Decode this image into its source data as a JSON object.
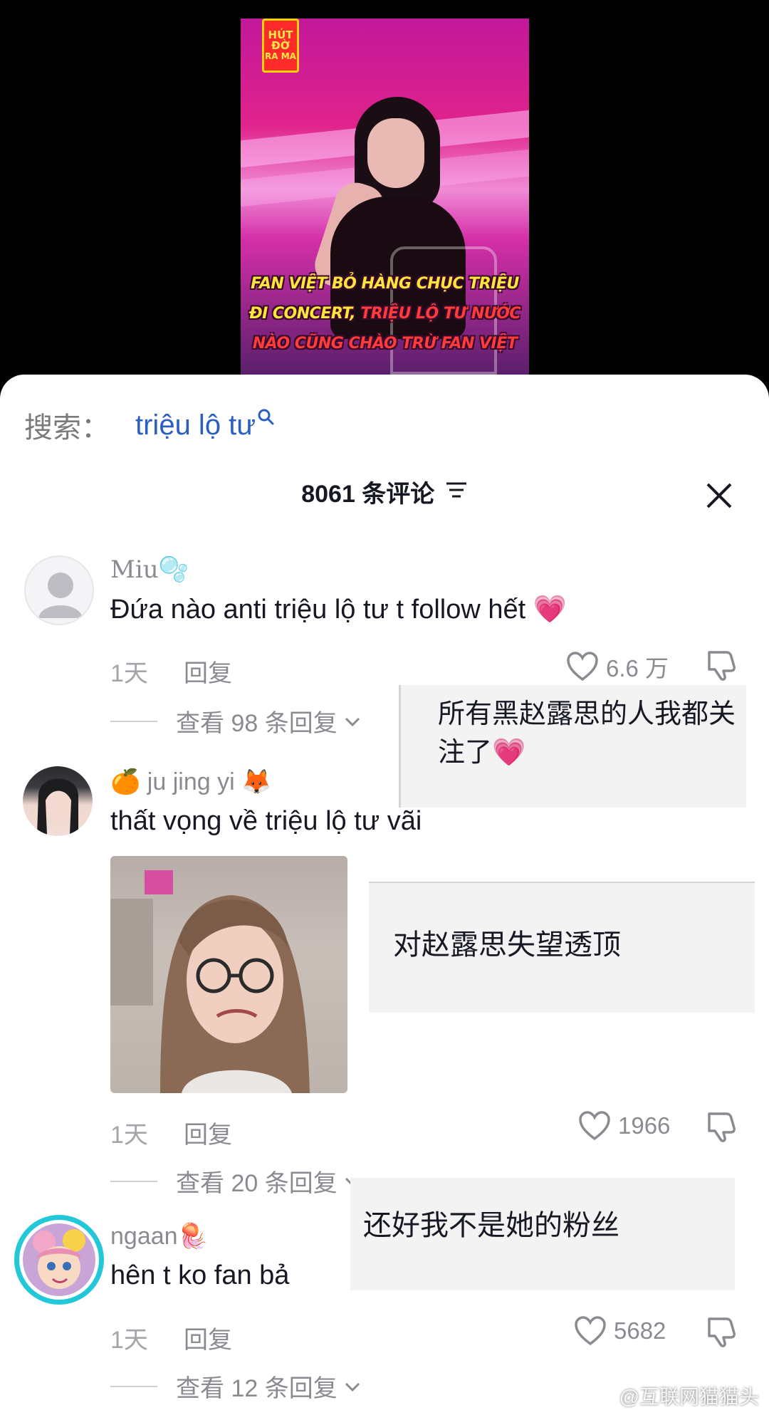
{
  "video": {
    "logo": [
      "HÚT",
      "ĐỜ",
      "RA MA"
    ],
    "caption_lines": [
      [
        {
          "text": "FAN VIỆT BỎ HÀNG CHỤC TRIỆU",
          "tone": "yellow"
        }
      ],
      [
        {
          "text": "ĐI CONCERT, ",
          "tone": "yellow"
        },
        {
          "text": "TRIỆU LỘ TƯ NƯỚC",
          "tone": "red"
        }
      ],
      [
        {
          "text": "NÀO CŨNG CHÀO TRỪ FAN VIỆT",
          "tone": "red"
        }
      ]
    ]
  },
  "search": {
    "label": "搜索：",
    "query": "triệu lộ tư"
  },
  "header": {
    "count_text": "8061 条评论"
  },
  "comments": [
    {
      "username": "Miu",
      "username_emoji": "🫧",
      "text": "Đứa nào anti triệu lộ tư t follow hết 💗",
      "time": "1天",
      "reply": "回复",
      "likes": "6.6 万",
      "view_replies": "查看 98 条回复"
    },
    {
      "username_prefix": "🍊",
      "username": "ju jing yi",
      "username_emoji": "🦊",
      "text": "thất vọng về triệu lộ tư vãi",
      "time": "1天",
      "reply": "回复",
      "likes": "1966",
      "view_replies": "查看 20 条回复"
    },
    {
      "username": "ngaan",
      "username_emoji": "🪼",
      "text": "hên t ko fan bả",
      "time": "1天",
      "reply": "回复",
      "likes": "5682",
      "view_replies": "查看 12 条回复"
    }
  ],
  "translations": [
    "所有黑赵露思的人我都关注了💗",
    "对赵露思失望透顶",
    "还好我不是她的粉丝"
  ],
  "watermark": "@互联网猫猫头",
  "colors": {
    "search_query": "#2b5fbf",
    "muted": "#8a8b91",
    "text": "#161823"
  }
}
